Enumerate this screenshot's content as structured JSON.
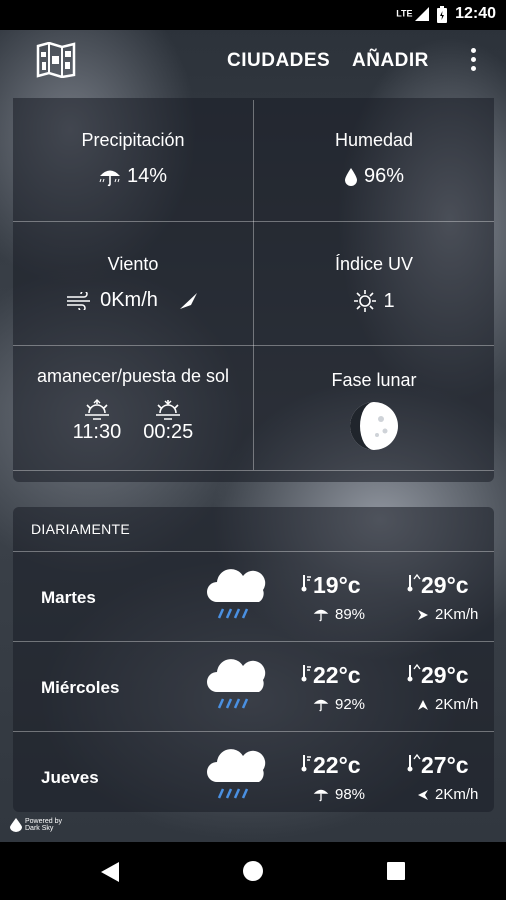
{
  "status": {
    "network": "LTE",
    "time": "12:40"
  },
  "appbar": {
    "cities_label": "CIUDADES",
    "add_label": "AÑADIR"
  },
  "details": {
    "precip": {
      "label": "Precipitación",
      "value": "14%"
    },
    "humidity": {
      "label": "Humedad",
      "value": "96%"
    },
    "wind": {
      "label": "Viento",
      "value": "0Km/h"
    },
    "uv": {
      "label": "Índice UV",
      "value": "1"
    },
    "sun": {
      "label": "amanecer/puesta de sol",
      "sunrise": "11:30",
      "sunset": "00:25"
    },
    "moon": {
      "label": "Fase lunar"
    }
  },
  "daily": {
    "header": "DIARIAMENTE",
    "days": [
      {
        "day": "Martes",
        "low": "19°c",
        "high": "29°c",
        "precip": "89%",
        "wind": "2Km/h"
      },
      {
        "day": "Miércoles",
        "low": "22°c",
        "high": "29°c",
        "precip": "92%",
        "wind": "2Km/h"
      },
      {
        "day": "Jueves",
        "low": "22°c",
        "high": "27°c",
        "precip": "98%",
        "wind": "2Km/h"
      }
    ]
  },
  "powered": {
    "line1": "Powered by",
    "line2": "Dark Sky"
  }
}
